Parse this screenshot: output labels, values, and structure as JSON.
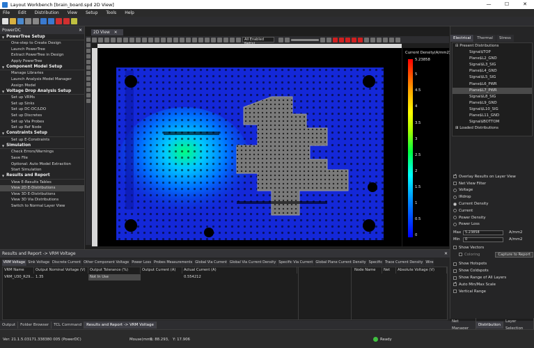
{
  "window": {
    "title": "Layout Workbench [brain_board.spd 2D View]",
    "minimize": "—",
    "maximize": "☐",
    "close": "✕"
  },
  "menu": [
    "File",
    "Edit",
    "Distribution",
    "View",
    "Setup",
    "Tools",
    "Help"
  ],
  "left_panel": {
    "title": "PowerDC",
    "sections": [
      {
        "label": "PowerTree Setup",
        "items": [
          "One-step to Create Design",
          "Launch PowerTree",
          "Extract PowerTree in Design",
          "Apply PowerTree"
        ]
      },
      {
        "label": "Component Model Setup",
        "items": [
          "Manage Libraries",
          "Launch Analysis Model Manager",
          "Assign Model"
        ]
      },
      {
        "label": "Voltage Drop Analysis Setup",
        "items": [
          "Set up VRMs",
          "Set up Sinks",
          "Set up DC-DC/LDO",
          "Set up Discretes",
          "Set up Via Probes",
          "Set up Ref Node"
        ]
      },
      {
        "label": "Constraints Setup",
        "items": [
          "Set up E-Constraints"
        ]
      },
      {
        "label": "Simulation",
        "items": [
          "Check Errors/Warnings",
          "Save File",
          "Optional: Auto Model Extraction",
          "Start Simulation"
        ]
      },
      {
        "label": "Results and Report",
        "items": [
          "View E-Results Tables",
          "View 2D E-Distributions",
          "View 3D E-Distributions",
          "View 3D Via Distributions",
          "Switch to Normal Layer View"
        ]
      }
    ],
    "selected_item": "View 2D E-Distributions"
  },
  "document": {
    "tab_label": "2D View",
    "net_filter": "All Enabled Net(s)"
  },
  "legend": {
    "title": "Current Density(A/mm2)",
    "ticks": [
      "5.23858",
      "5",
      "4.5",
      "4",
      "3.5",
      "3",
      "2.5",
      "2",
      "1.5",
      "1",
      "0.5",
      "0"
    ]
  },
  "right_panel": {
    "tabs": [
      "Electrical",
      "Thermal",
      "Stress"
    ],
    "active_tab": "Electrical",
    "tree_root": "Present Distributions",
    "layers": [
      "Signal$TOP",
      "Plane$L2_GND",
      "Signal$L3_SIG",
      "Plane$L4_GND",
      "Signal$L5_SIG",
      "Plane$L6_PWR",
      "Plane$L7_PWR",
      "Signal$L8_SIG",
      "Plane$L9_GND",
      "Signal$L10_SIG",
      "Plane$L11_GND",
      "Signal$BOTTOM"
    ],
    "highlighted_layer": "Plane$L7_PWR",
    "loaded_root": "Loaded Distributions",
    "overlay_label": "Overlay Results on Layer View",
    "net_view_filter": "Net View Filter",
    "radios": [
      "Voltage",
      "IRdrop",
      "Current Density",
      "Current",
      "Power Density",
      "Power Loss"
    ],
    "selected_radio": "Current Density",
    "max_label": "Max",
    "max_value": "5.23858",
    "min_label": "Min",
    "min_value": "0",
    "unit": "A/mm2",
    "show_vectors": "Show Vectors",
    "coloring": "Coloring",
    "copy_button": "Capture to Report",
    "checks": [
      "Show Hotspots",
      "Show Coldspots",
      "Show Range of All Layers",
      "Auto Min/Max Scale",
      "Vertical Range"
    ],
    "checked": [
      "Auto Min/Max Scale"
    ],
    "bottom_tabs": [
      "Net Manager",
      "Distribution",
      "Layer Selection"
    ],
    "active_bottom_tab": "Distribution"
  },
  "bottom_panel": {
    "title": "Results and Report -> VRM Voltage",
    "tabs": [
      "VRM Voltage",
      "Sink Voltage",
      "Discrete Current",
      "Other Component Voltage",
      "Power Loss",
      "Probes Measurements",
      "Global Via Current",
      "Global Via Current Density",
      "Specific Via Current",
      "Global Plane Current Density",
      "Specific",
      "Trace Current Density",
      "Wireb"
    ],
    "active_tab": "VRM Voltage",
    "columns": [
      "VRM Name",
      "Output Nominal Voltage (V)",
      "Output Tolerance (%)",
      "Output Current (A)",
      "Actual Current (A)"
    ],
    "row": [
      "VRM_U30_R29...",
      "1.35",
      "Not In Use",
      "",
      "0.554212"
    ],
    "columns2": [
      "Node Name",
      "Net",
      "Absolute Voltage (V)"
    ]
  },
  "bottom_tabs": [
    "Output",
    "Folder Browser",
    "TCL Command",
    "Results and Report -> VRM Voltage"
  ],
  "active_bottom_tab": "Results and Report -> VRM Voltage",
  "status": {
    "version": "Ver: 21.1.5.03171.338380 005 (PowerDC)",
    "mouse_label": "Mouse(mm):",
    "x": "X: 88.293,",
    "y": "Y: 17.906",
    "ready": "Ready"
  },
  "colors": {
    "accent": "#0078d4",
    "board_plane": "#1020d0",
    "hotspot": "#00ff60",
    "ground_metal": "#7a7a7a"
  }
}
